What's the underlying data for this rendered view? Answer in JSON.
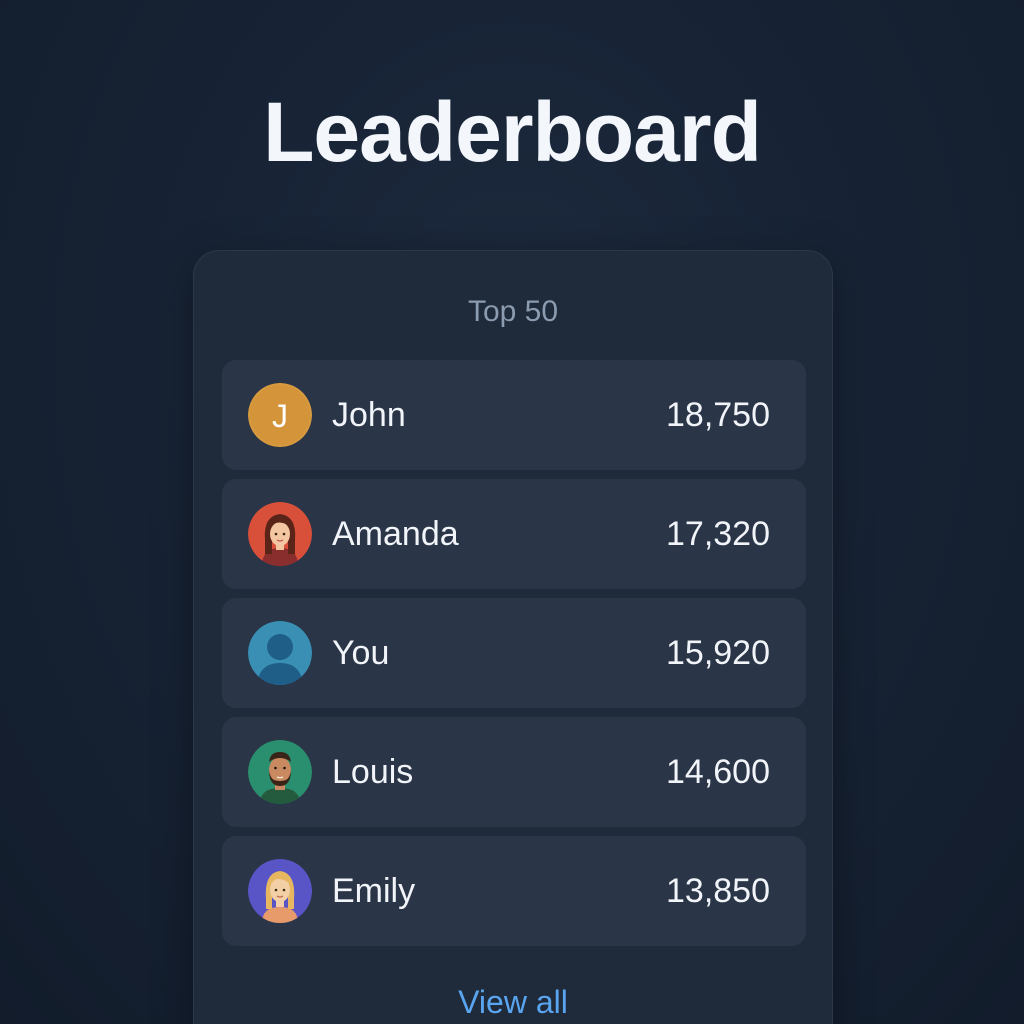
{
  "header": {
    "title": "Leaderboard"
  },
  "card": {
    "subtitle": "Top 50",
    "view_all_label": "View all"
  },
  "leaderboard": [
    {
      "name": "John",
      "score": "18,750",
      "avatar": "initial-avatar",
      "initial": "J",
      "avatar_color": "#d89a3e"
    },
    {
      "name": "Amanda",
      "score": "17,320",
      "avatar": "woman-avatar-icon",
      "avatar_color": "#d8503a"
    },
    {
      "name": "You",
      "score": "15,920",
      "avatar": "user-silhouette-icon",
      "avatar_color": "#3a8fb5"
    },
    {
      "name": "Louis",
      "score": "14,600",
      "avatar": "bearded-man-avatar-icon",
      "avatar_color": "#2a8f6e"
    },
    {
      "name": "Emily",
      "score": "13,850",
      "avatar": "blonde-woman-avatar-icon",
      "avatar_color": "#5a55c7"
    }
  ],
  "colors": {
    "background": "#172335",
    "card": "#1f2a3a",
    "row": "#2a3547",
    "link": "#5aa5f0",
    "subtitle": "#8b9bb0"
  }
}
